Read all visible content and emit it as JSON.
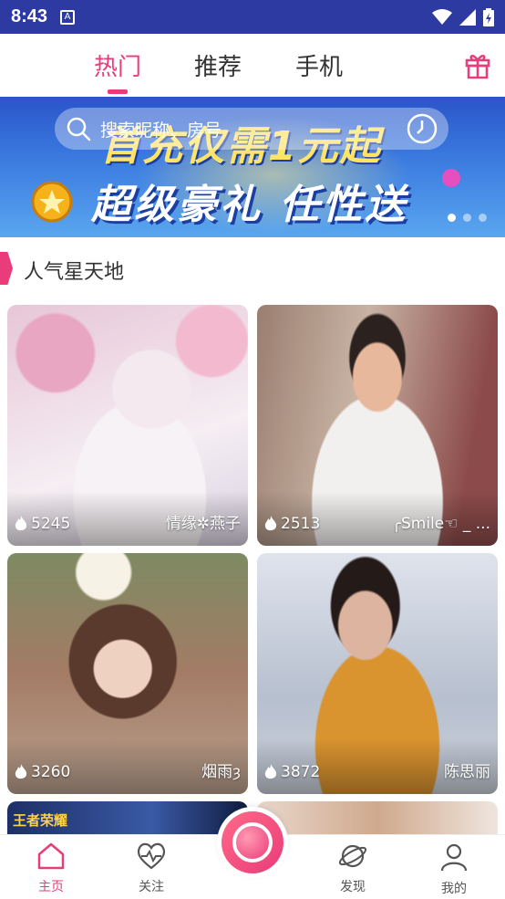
{
  "status_bar": {
    "time": "8:43",
    "indicator_letter": "A"
  },
  "tabs": [
    {
      "label": "热门",
      "active": true
    },
    {
      "label": "推荐",
      "active": false
    },
    {
      "label": "手机",
      "active": false
    }
  ],
  "banner": {
    "search_placeholder": "搜索昵称、房号",
    "headline": "首充仅需1元起",
    "subheadline": "超级豪礼 任性送",
    "pager": {
      "count": 3,
      "active": 1
    }
  },
  "section": {
    "title": "人气星天地"
  },
  "cards": [
    {
      "viewers": "5245",
      "name": "情缘✲燕子"
    },
    {
      "viewers": "2513",
      "name": "╭Smile☜ _ ..."
    },
    {
      "viewers": "3260",
      "name": "烟雨ȝ"
    },
    {
      "viewers": "3872",
      "name": "陈思丽"
    }
  ],
  "partial_card_text": "王者荣耀",
  "bottom_nav": {
    "home": "主页",
    "follow": "关注",
    "discover": "发现",
    "mine": "我的"
  },
  "colors": {
    "accent": "#ea3b7a",
    "status_bar": "#2d3aa1"
  }
}
